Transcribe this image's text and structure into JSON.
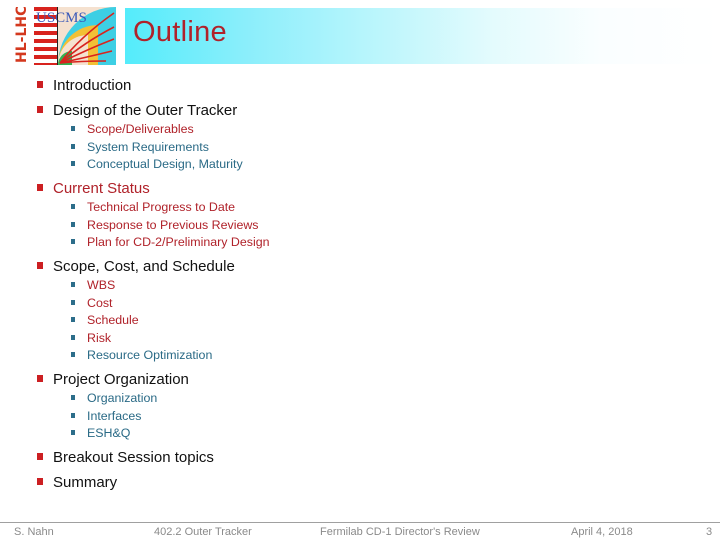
{
  "header": {
    "title": "Outline",
    "logo": {
      "vertical_text": "HL-LHC",
      "brand_text": "USCMS"
    }
  },
  "outline": [
    {
      "label": "Introduction",
      "color": "#111111",
      "children": []
    },
    {
      "label": "Design of the Outer Tracker",
      "color": "#111111",
      "children": [
        {
          "label": "Scope/Deliverables",
          "color": "#b0222a"
        },
        {
          "label": "System Requirements",
          "color": "#2a6a86"
        },
        {
          "label": "Conceptual Design, Maturity",
          "color": "#2a6a86"
        }
      ]
    },
    {
      "label": "Current Status",
      "color": "#b0222a",
      "children": [
        {
          "label": "Technical Progress to Date",
          "color": "#b0222a"
        },
        {
          "label": "Response to Previous Reviews",
          "color": "#b0222a"
        },
        {
          "label": "Plan for CD-2/Preliminary Design",
          "color": "#b0222a"
        }
      ]
    },
    {
      "label": "Scope, Cost, and Schedule",
      "color": "#111111",
      "children": [
        {
          "label": "WBS",
          "color": "#b0222a"
        },
        {
          "label": "Cost",
          "color": "#b0222a"
        },
        {
          "label": "Schedule",
          "color": "#b0222a"
        },
        {
          "label": "Risk",
          "color": "#b0222a"
        },
        {
          "label": "Resource Optimization",
          "color": "#2a6a86"
        }
      ]
    },
    {
      "label": "Project Organization",
      "color": "#111111",
      "children": [
        {
          "label": "Organization",
          "color": "#2a6a86"
        },
        {
          "label": "Interfaces",
          "color": "#2a6a86"
        },
        {
          "label": "ESH&Q",
          "color": "#2a6a86"
        }
      ]
    },
    {
      "label": "Breakout Session topics",
      "color": "#111111",
      "children": []
    },
    {
      "label": "Summary",
      "color": "#111111",
      "children": []
    }
  ],
  "footer": {
    "author": "S. Nahn",
    "subtitle": "402.2 Outer Tracker",
    "event": "Fermilab CD-1 Director's Review",
    "date": "April 4, 2018",
    "page_number": "3"
  },
  "colors": {
    "title": "#b0222a",
    "bullet_l1": "#cc1f22",
    "bullet_l2": "#2c6d8a",
    "title_bar_start": "#54ecfb"
  }
}
